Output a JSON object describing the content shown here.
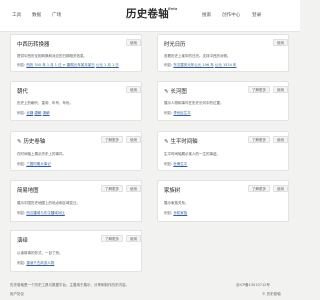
{
  "nav": {
    "left_links": [
      "工具",
      "数据",
      "广场"
    ],
    "logo": "历史卷轴",
    "beta": "Beta",
    "right_links": [
      "搜索",
      "创作中心",
      "登录"
    ]
  },
  "cards": [
    {
      "title": "中西历转换器",
      "actions": [
        "使用"
      ],
      "desc": "提供中西历互相转换和对应的日期相关信息。",
      "example_label": "例如:",
      "example_parts": [
        "西历 300 年 1 月 1 日 ↔ 康熙元年某月某日",
        "公元 1 月 1 日"
      ]
    },
    {
      "title": "时光日历",
      "actions": [
        "使用"
      ],
      "desc": "查看历史上某年的日历。支持中西历对照。",
      "example_label": "例如:",
      "example_parts": [
        "东汉建安元年公元 196 年",
        "公元 1534 年"
      ]
    },
    {
      "title": "朝代",
      "actions": [
        "使用"
      ],
      "desc": "历史上的朝代、皇帝、年号、年份。",
      "example_label": "例如:",
      "example_parts": [
        "北魏",
        "唐朝",
        "清朝"
      ]
    },
    {
      "title": "长河图",
      "actions": [
        "了解更多",
        "使用"
      ],
      "desc": "展示人物和事件在历史长河中的位置。",
      "example_label": "例如:",
      "example_parts": [
        "李世民生平"
      ]
    },
    {
      "title": "历史卷轴",
      "actions": [
        "了解更多",
        "使用"
      ],
      "desc": "在时间轴上展示历史上的事件。",
      "example_label": "例如:",
      "example_parts": [
        "三国时期大事记"
      ]
    },
    {
      "title": "生平时间轴",
      "actions": [
        "了解更多",
        "使用"
      ],
      "desc": "生平时间轴展示某人的一生的事迹。",
      "example_label": "例如:",
      "example_parts": [
        "杜甫生平"
      ]
    },
    {
      "title": "简易地图",
      "actions": [
        "了解更多",
        "使用"
      ],
      "desc": "展示中国历史地图上的地点和区域变迁。",
      "example_label": "例如:",
      "example_parts": [
        "西汉疆域与东汉疆域对比"
      ]
    },
    {
      "title": "家族树",
      "actions": [
        "了解更多",
        "使用"
      ],
      "desc": "展示家族关系。",
      "example_label": "例如:",
      "example_parts": [
        "孙权家族"
      ]
    },
    {
      "title": "演绎",
      "actions": [
        "了解更多",
        "使用"
      ],
      "desc": "以读故事的形式，一目了然。",
      "example_label": "例如:",
      "example_parts": [
        "重读千古风流人物"
      ]
    }
  ],
  "footer": {
    "left": "历史卷轴是一个历史工具与数据平台，主要用于展示、分享和制作历史内容。",
    "right": "京ICP备13015712号",
    "left2": "用户协议",
    "right2": "© 历史卷轴"
  }
}
